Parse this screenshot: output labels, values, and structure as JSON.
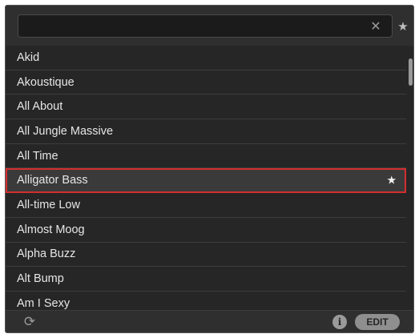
{
  "search": {
    "value": "",
    "placeholder": "",
    "clear_icon": "close-icon",
    "favorites_icon": "star-icon",
    "clear_glyph": "✕",
    "favorites_glyph": "★"
  },
  "list": {
    "items": [
      {
        "label": "Akid",
        "favorite": false
      },
      {
        "label": "Akoustique",
        "favorite": false
      },
      {
        "label": "All About",
        "favorite": false
      },
      {
        "label": "All Jungle Massive",
        "favorite": false
      },
      {
        "label": "All Time",
        "favorite": false
      },
      {
        "label": "Alligator Bass",
        "favorite": true,
        "selected": true
      },
      {
        "label": "All-time Low",
        "favorite": false
      },
      {
        "label": "Almost Moog",
        "favorite": false
      },
      {
        "label": "Alpha Buzz",
        "favorite": false
      },
      {
        "label": "Alt Bump",
        "favorite": false
      },
      {
        "label": "Am I Sexy",
        "favorite": false
      }
    ],
    "favorite_glyph": "★"
  },
  "footer": {
    "sync_icon": "sync-icon",
    "sync_glyph": "⟳",
    "info_glyph": "i",
    "edit_label": "EDIT"
  },
  "colors": {
    "background": "#262626",
    "selection_outline": "#d32f2f",
    "text": "#e6e6e6"
  }
}
